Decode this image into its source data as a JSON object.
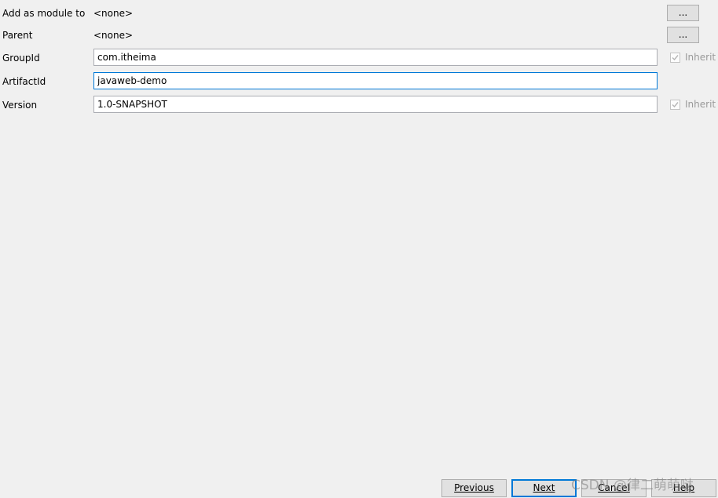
{
  "form": {
    "add_as_module": {
      "label": "Add as module to",
      "value": "<none>",
      "browse_label": "..."
    },
    "parent": {
      "label": "Parent",
      "value": "<none>",
      "browse_label": "..."
    },
    "group_id": {
      "label": "GroupId",
      "value": "com.itheima",
      "inherit_label": "Inherit",
      "inherit_checked": true
    },
    "artifact_id": {
      "label": "ArtifactId",
      "value": "javaweb-demo"
    },
    "version": {
      "label": "Version",
      "value": "1.0-SNAPSHOT",
      "inherit_label": "Inherit",
      "inherit_checked": true
    }
  },
  "footer": {
    "previous_label": "Previous",
    "next_label": "Next",
    "cancel_label": "Cancel",
    "help_label": "Help"
  },
  "watermark": "CSDN @律二萌萌哒",
  "colors": {
    "background": "#f0f0f0",
    "focus_border": "#0078d7",
    "field_border": "#abadb3",
    "button_face": "#e1e1e1"
  }
}
